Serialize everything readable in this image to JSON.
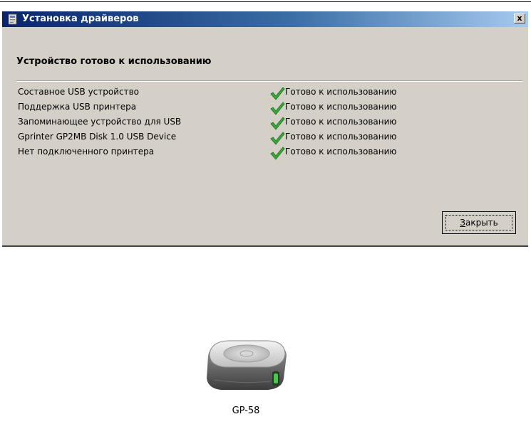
{
  "dialog": {
    "title": "Установка драйверов",
    "close_glyph": "x",
    "heading": "Устройство готово к использованию",
    "devices": [
      {
        "name": "Составное USB устройство",
        "status": "Готово к использованию"
      },
      {
        "name": "Поддержка USB принтера",
        "status": "Готово к использованию"
      },
      {
        "name": "Запоминающее устройство для USB",
        "status": "Готово к использованию"
      },
      {
        "name": "Gprinter GP2MB Disk  1.0 USB Device",
        "status": "Готово к использованию"
      },
      {
        "name": "Нет подключенного принтера",
        "status": "Готово к использованию"
      }
    ],
    "close_button": {
      "accel_char": "З",
      "rest_label": "акрыть"
    },
    "icons": {
      "title": "driver-setup-icon",
      "status": "green-check-icon"
    },
    "colors": {
      "titlebar_start": "#0a246a",
      "titlebar_end": "#a6caf0",
      "dialog_bg": "#d4d0c8",
      "check": "#3aa83a"
    }
  },
  "desktop_item": {
    "label": "GP-58",
    "icon": "external-drive-icon"
  }
}
